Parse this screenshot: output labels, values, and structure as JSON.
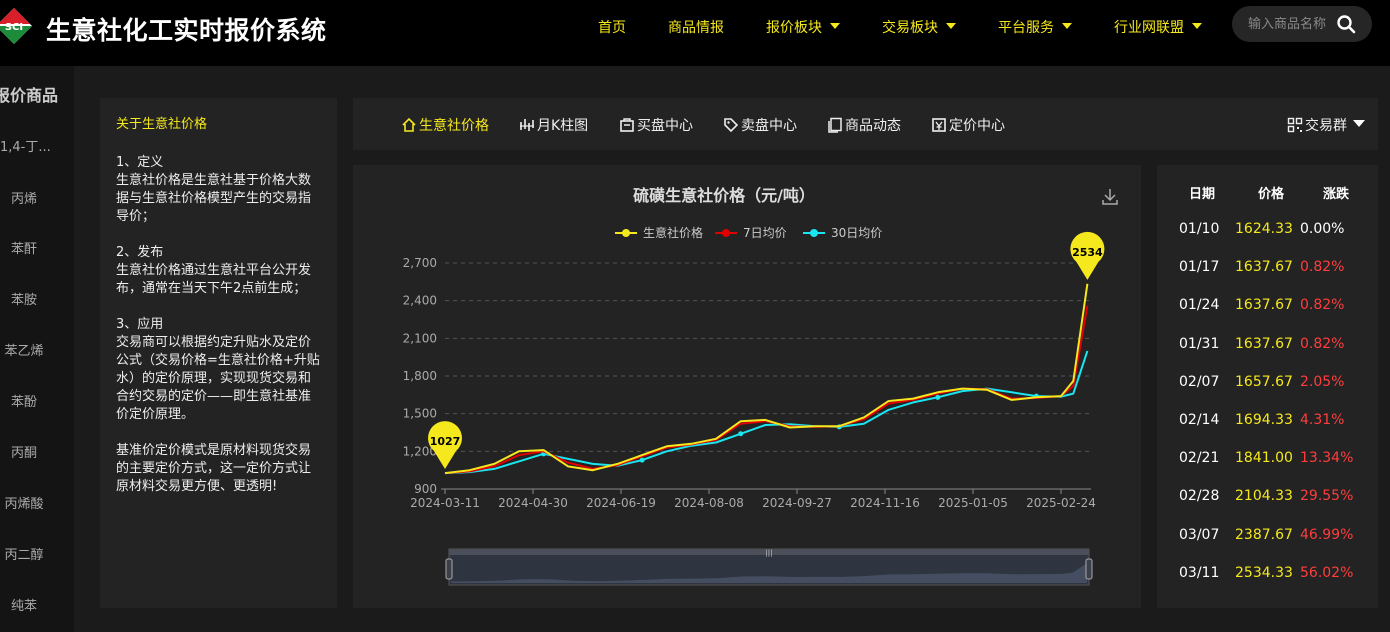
{
  "header": {
    "brand": "生意社化工实时报价系统",
    "logo_text": "SCI",
    "nav": [
      {
        "label": "首页",
        "dropdown": false
      },
      {
        "label": "商品情报",
        "dropdown": false
      },
      {
        "label": "报价板块",
        "dropdown": true
      },
      {
        "label": "交易板块",
        "dropdown": true
      },
      {
        "label": "平台服务",
        "dropdown": true
      },
      {
        "label": "行业网联盟",
        "dropdown": true
      }
    ],
    "search_placeholder": "输入商品名称"
  },
  "sidebar": {
    "title": "报价商品",
    "items": [
      "1,4-丁...",
      "丙烯",
      "苯酐",
      "苯胺",
      "苯乙烯",
      "苯酚",
      "丙酮",
      "丙烯酸",
      "丙二醇",
      "纯苯"
    ]
  },
  "about": {
    "title": "关于生意社价格",
    "paragraphs": [
      "1、定义\n生意社价格是生意社基于价格大数据与生意社价格模型产生的交易指导价；",
      "2、发布\n生意社价格通过生意社平台公开发布，通常在当天下午2点前生成；",
      "3、应用\n交易商可以根据约定升贴水及定价公式（交易价格=生意社价格+升贴水）的定价原理，实现现货交易和合约交易的定价——即生意社基准价定价原理。",
      "基准价定价模式是原材料现货交易的主要定价方式，这一定价方式让原材料交易更方便、更透明!"
    ]
  },
  "tabs": [
    {
      "label": "生意社价格",
      "icon": "home-icon",
      "active": true
    },
    {
      "label": "月K柱图",
      "icon": "kline-icon",
      "active": false
    },
    {
      "label": "买盘中心",
      "icon": "cart-icon",
      "active": false
    },
    {
      "label": "卖盘中心",
      "icon": "tag-icon",
      "active": false
    },
    {
      "label": "商品动态",
      "icon": "copy-icon",
      "active": false
    },
    {
      "label": "定价中心",
      "icon": "calendar-icon",
      "active": false
    }
  ],
  "group_label": "交易群",
  "colors": {
    "accent": "#f5e81c",
    "ma7": "#e00000",
    "ma30": "#19e6f0",
    "down": "#ff3d3d"
  },
  "chart_data": {
    "type": "line",
    "title": "硫磺生意社价格（元/吨）",
    "legend": [
      "生意社价格",
      "7日均价",
      "30日均价"
    ],
    "legend_placement": "top-center",
    "ylim": [
      900,
      2700
    ],
    "yticks": [
      "900",
      "1,200",
      "1,500",
      "1,800",
      "2,100",
      "2,400",
      "2,700"
    ],
    "xticks": [
      "2024-03-11",
      "2024-04-30",
      "2024-06-19",
      "2024-08-08",
      "2024-09-27",
      "2024-11-16",
      "2025-01-05",
      "2025-02-24"
    ],
    "grid": true,
    "start_marker": "1027",
    "end_marker": "2534",
    "x": [
      "2024-03-11",
      "2024-03-25",
      "2024-04-08",
      "2024-04-22",
      "2024-05-06",
      "2024-05-20",
      "2024-06-03",
      "2024-06-17",
      "2024-07-01",
      "2024-07-15",
      "2024-07-29",
      "2024-08-12",
      "2024-08-26",
      "2024-09-09",
      "2024-09-23",
      "2024-10-07",
      "2024-10-21",
      "2024-11-04",
      "2024-11-18",
      "2024-12-02",
      "2024-12-16",
      "2024-12-30",
      "2025-01-13",
      "2025-01-27",
      "2025-02-10",
      "2025-02-24",
      "2025-03-03",
      "2025-03-11"
    ],
    "series": [
      {
        "name": "生意社价格",
        "values": [
          1027,
          1050,
          1100,
          1200,
          1210,
          1080,
          1050,
          1100,
          1170,
          1240,
          1260,
          1300,
          1440,
          1450,
          1390,
          1400,
          1400,
          1470,
          1600,
          1620,
          1670,
          1700,
          1690,
          1610,
          1630,
          1640,
          1760,
          2534
        ]
      },
      {
        "name": "7日均价",
        "values": [
          1027,
          1040,
          1080,
          1170,
          1200,
          1110,
          1060,
          1090,
          1160,
          1230,
          1255,
          1290,
          1420,
          1440,
          1400,
          1395,
          1400,
          1455,
          1580,
          1610,
          1660,
          1700,
          1695,
          1620,
          1625,
          1640,
          1720,
          2360
        ]
      },
      {
        "name": "30日均价",
        "values": [
          1027,
          1035,
          1060,
          1120,
          1180,
          1140,
          1100,
          1085,
          1130,
          1200,
          1245,
          1270,
          1340,
          1410,
          1415,
          1400,
          1395,
          1420,
          1530,
          1590,
          1630,
          1680,
          1700,
          1670,
          1640,
          1635,
          1660,
          2000
        ]
      }
    ]
  },
  "price_table": {
    "headers": [
      "日期",
      "价格",
      "涨跌"
    ],
    "rows": [
      [
        "01/10",
        "1624.33",
        "0.00%"
      ],
      [
        "01/17",
        "1637.67",
        "0.82%"
      ],
      [
        "01/24",
        "1637.67",
        "0.82%"
      ],
      [
        "01/31",
        "1637.67",
        "0.82%"
      ],
      [
        "02/07",
        "1657.67",
        "2.05%"
      ],
      [
        "02/14",
        "1694.33",
        "4.31%"
      ],
      [
        "02/21",
        "1841.00",
        "13.34%"
      ],
      [
        "02/28",
        "2104.33",
        "29.55%"
      ],
      [
        "03/07",
        "2387.67",
        "46.99%"
      ],
      [
        "03/11",
        "2534.33",
        "56.02%"
      ]
    ]
  }
}
